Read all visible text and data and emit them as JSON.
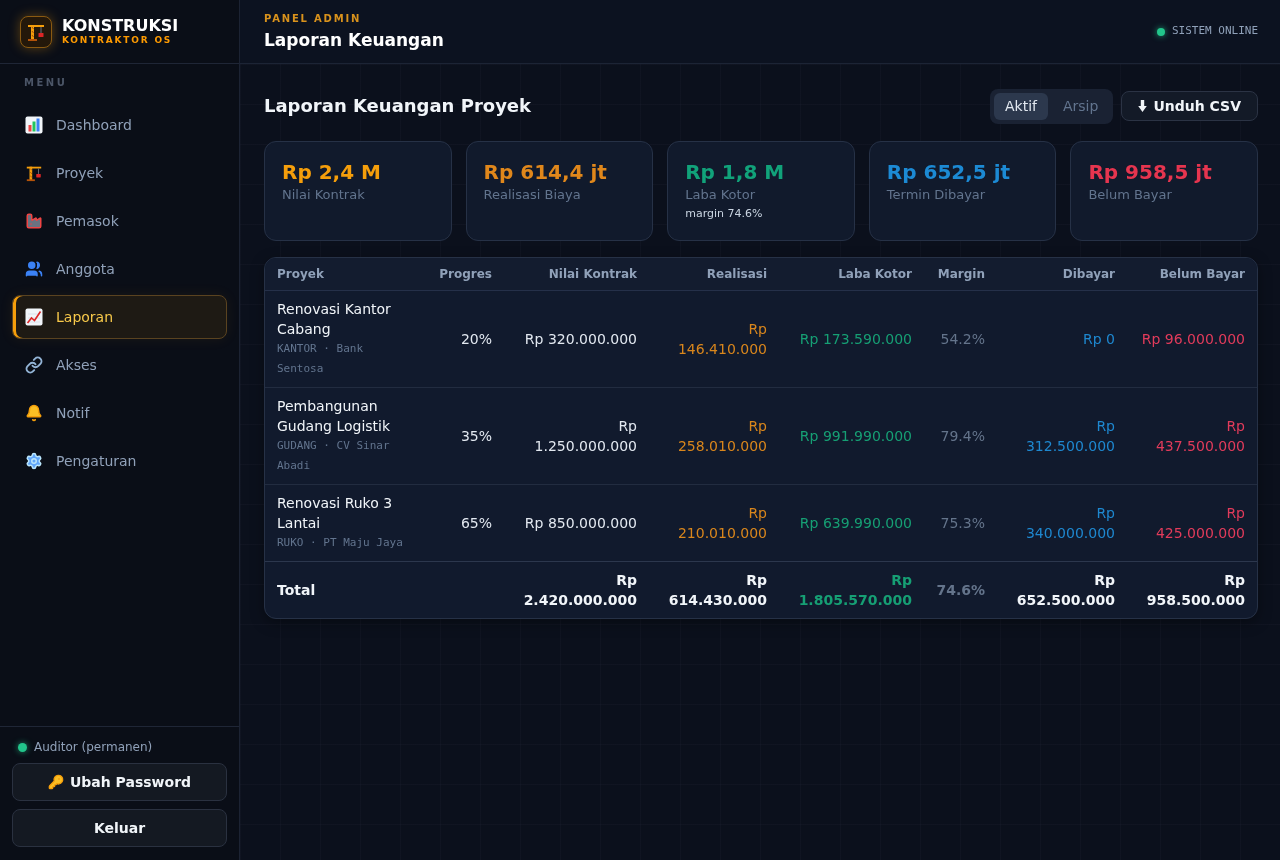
{
  "sidebar": {
    "brand": {
      "name": "KONSTRUKSI",
      "tagline": "KONTRAKTOR OS"
    },
    "menu_title": "MENU",
    "items": [
      {
        "label": "Dashboard",
        "selected": false
      },
      {
        "label": "Proyek",
        "selected": false
      },
      {
        "label": "Pemasok",
        "selected": false
      },
      {
        "label": "Anggota",
        "selected": false
      },
      {
        "label": "Laporan",
        "selected": true
      },
      {
        "label": "Akses",
        "selected": false
      },
      {
        "label": "Notif",
        "selected": false
      },
      {
        "label": "Pengaturan",
        "selected": false
      }
    ],
    "user": {
      "label": "Auditor (permanen)",
      "online": true
    },
    "buttons": [
      {
        "label": "Ubah Password",
        "kind": "key"
      },
      {
        "label": "Keluar",
        "kind": "plain"
      }
    ]
  },
  "header": {
    "eyebrow": "PANEL ADMIN",
    "title": "Laporan Keuangan",
    "status": {
      "label": "SISTEM ONLINE",
      "online": true
    }
  },
  "report": {
    "title": "Laporan Keuangan Proyek",
    "filters": [
      {
        "label": "Aktif",
        "selected": true
      },
      {
        "label": "Arsip",
        "selected": false
      }
    ],
    "export_button": "Unduh CSV",
    "stats": [
      {
        "value": "Rp 2,4 M",
        "label": "Nilai Kontrak",
        "color": "#f59e0b"
      },
      {
        "value": "Rp 614,4 jt",
        "label": "Realisasi Biaya",
        "color": "#e0871b"
      },
      {
        "value": "Rp 1,8 M",
        "label": "Laba Kotor",
        "note": "margin 74.6%",
        "color": "#11a27a"
      },
      {
        "value": "Rp 652,5 jt",
        "label": "Termin Dibayar",
        "color": "#1c8ad4"
      },
      {
        "value": "Rp 958,5 jt",
        "label": "Belum Bayar",
        "color": "#e6354f"
      }
    ],
    "table": {
      "columns": [
        {
          "label": "Proyek",
          "color": "#f1f5f9"
        },
        {
          "label": "Progres",
          "color": "#e2e8f0"
        },
        {
          "label": "Nilai Kontrak",
          "color": "#e2e8f0"
        },
        {
          "label": "Realisasi",
          "color": "#d9861c"
        },
        {
          "label": "Laba Kotor",
          "color": "#169f74"
        },
        {
          "label": "Margin",
          "color": "#64748b"
        },
        {
          "label": "Dibayar",
          "color": "#1e88d0"
        },
        {
          "label": "Belum Bayar",
          "color": "#e23b5b"
        }
      ],
      "rows": [
        {
          "kind": "project",
          "cells": [
            {
              "text": "Renovasi Kantor Cabang",
              "meta": "KANTOR · Bank Sentosa"
            },
            {
              "text": "20%"
            },
            {
              "text": "Rp 320.000.000"
            },
            {
              "text": "Rp 146.410.000"
            },
            {
              "text": "Rp 173.590.000"
            },
            {
              "text": "54.2%"
            },
            {
              "text": "Rp 0"
            },
            {
              "text": "Rp 96.000.000"
            }
          ]
        },
        {
          "kind": "project",
          "cells": [
            {
              "text": "Pembangunan Gudang Logistik",
              "meta": "GUDANG · CV Sinar Abadi"
            },
            {
              "text": "35%"
            },
            {
              "text": "Rp 1.250.000.000"
            },
            {
              "text": "Rp 258.010.000"
            },
            {
              "text": "Rp 991.990.000"
            },
            {
              "text": "79.4%"
            },
            {
              "text": "Rp 312.500.000"
            },
            {
              "text": "Rp 437.500.000"
            }
          ]
        },
        {
          "kind": "project",
          "cells": [
            {
              "text": "Renovasi Ruko 3 Lantai",
              "meta": "RUKO · PT Maju Jaya"
            },
            {
              "text": "65%"
            },
            {
              "text": "Rp 850.000.000"
            },
            {
              "text": "Rp 210.010.000"
            },
            {
              "text": "Rp 639.990.000"
            },
            {
              "text": "75.3%"
            },
            {
              "text": "Rp 340.000.000"
            },
            {
              "text": "Rp 425.000.000"
            }
          ]
        },
        {
          "kind": "total",
          "cells": [
            {
              "text": "Total",
              "color": "#f1f5f9"
            },
            {
              "text": ""
            },
            {
              "text": "Rp 2.420.000.000",
              "color": "#f1f5f9"
            },
            {
              "text": "Rp 614.430.000",
              "color": "#f1f5f9"
            },
            {
              "text": "Rp 1.805.570.000",
              "color": "#169f74"
            },
            {
              "text": "74.6%",
              "color": "#64748b"
            },
            {
              "text": "Rp 652.500.000",
              "color": "#f1f5f9"
            },
            {
              "text": "Rp 958.500.000",
              "color": "#f1f5f9"
            }
          ]
        }
      ]
    }
  }
}
